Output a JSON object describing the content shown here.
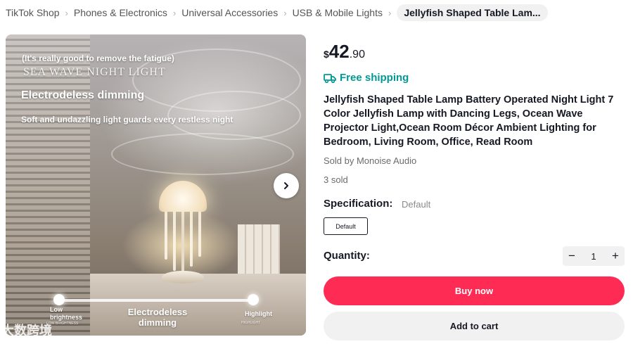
{
  "breadcrumb": {
    "items": [
      "TikTok Shop",
      "Phones & Electronics",
      "Universal Accessories",
      "USB & Mobile Lights"
    ],
    "current": "Jellyfish Shaped Table Lam..."
  },
  "media": {
    "fatigue_text": "(It's really good to remove the fatigue)",
    "sea_text": "SEA WAVE NIGHT LIGHT",
    "dimming_text": "Electrodeless dimming",
    "soft_text": "Soft and undazzling light guards every restless night",
    "low_label": "Low brightness",
    "low_sub": "LOW BRIGHTNESS",
    "center_label": "Electrodeless dimming",
    "high_label": "Highlight",
    "high_sub": "HIGHLIGHT",
    "watermark": "大数跨境",
    "next_icon": "chevron-right-icon"
  },
  "product": {
    "currency": "$",
    "price_int": "42",
    "price_dec": ".90",
    "shipping": "Free shipping",
    "title": "Jellyfish Shaped Table Lamp Battery Operated Night Light 7 Color Jellyfish Lamp with Dancing Legs, Ocean Wave Projector Light,Ocean Room Décor Ambient Lighting for Bedroom, Living Room, Office, Read Room",
    "seller": "Sold by Monoise Audio",
    "sold": "3 sold",
    "spec_label": "Specification:",
    "spec_value": "Default",
    "spec_option": "Default",
    "qty_label": "Quantity:",
    "qty_value": "1",
    "qty_minus": "−",
    "qty_plus": "+",
    "buy_label": "Buy now",
    "cart_label": "Add to cart"
  },
  "colors": {
    "accent": "#fe2c55",
    "shipping": "#009995"
  }
}
